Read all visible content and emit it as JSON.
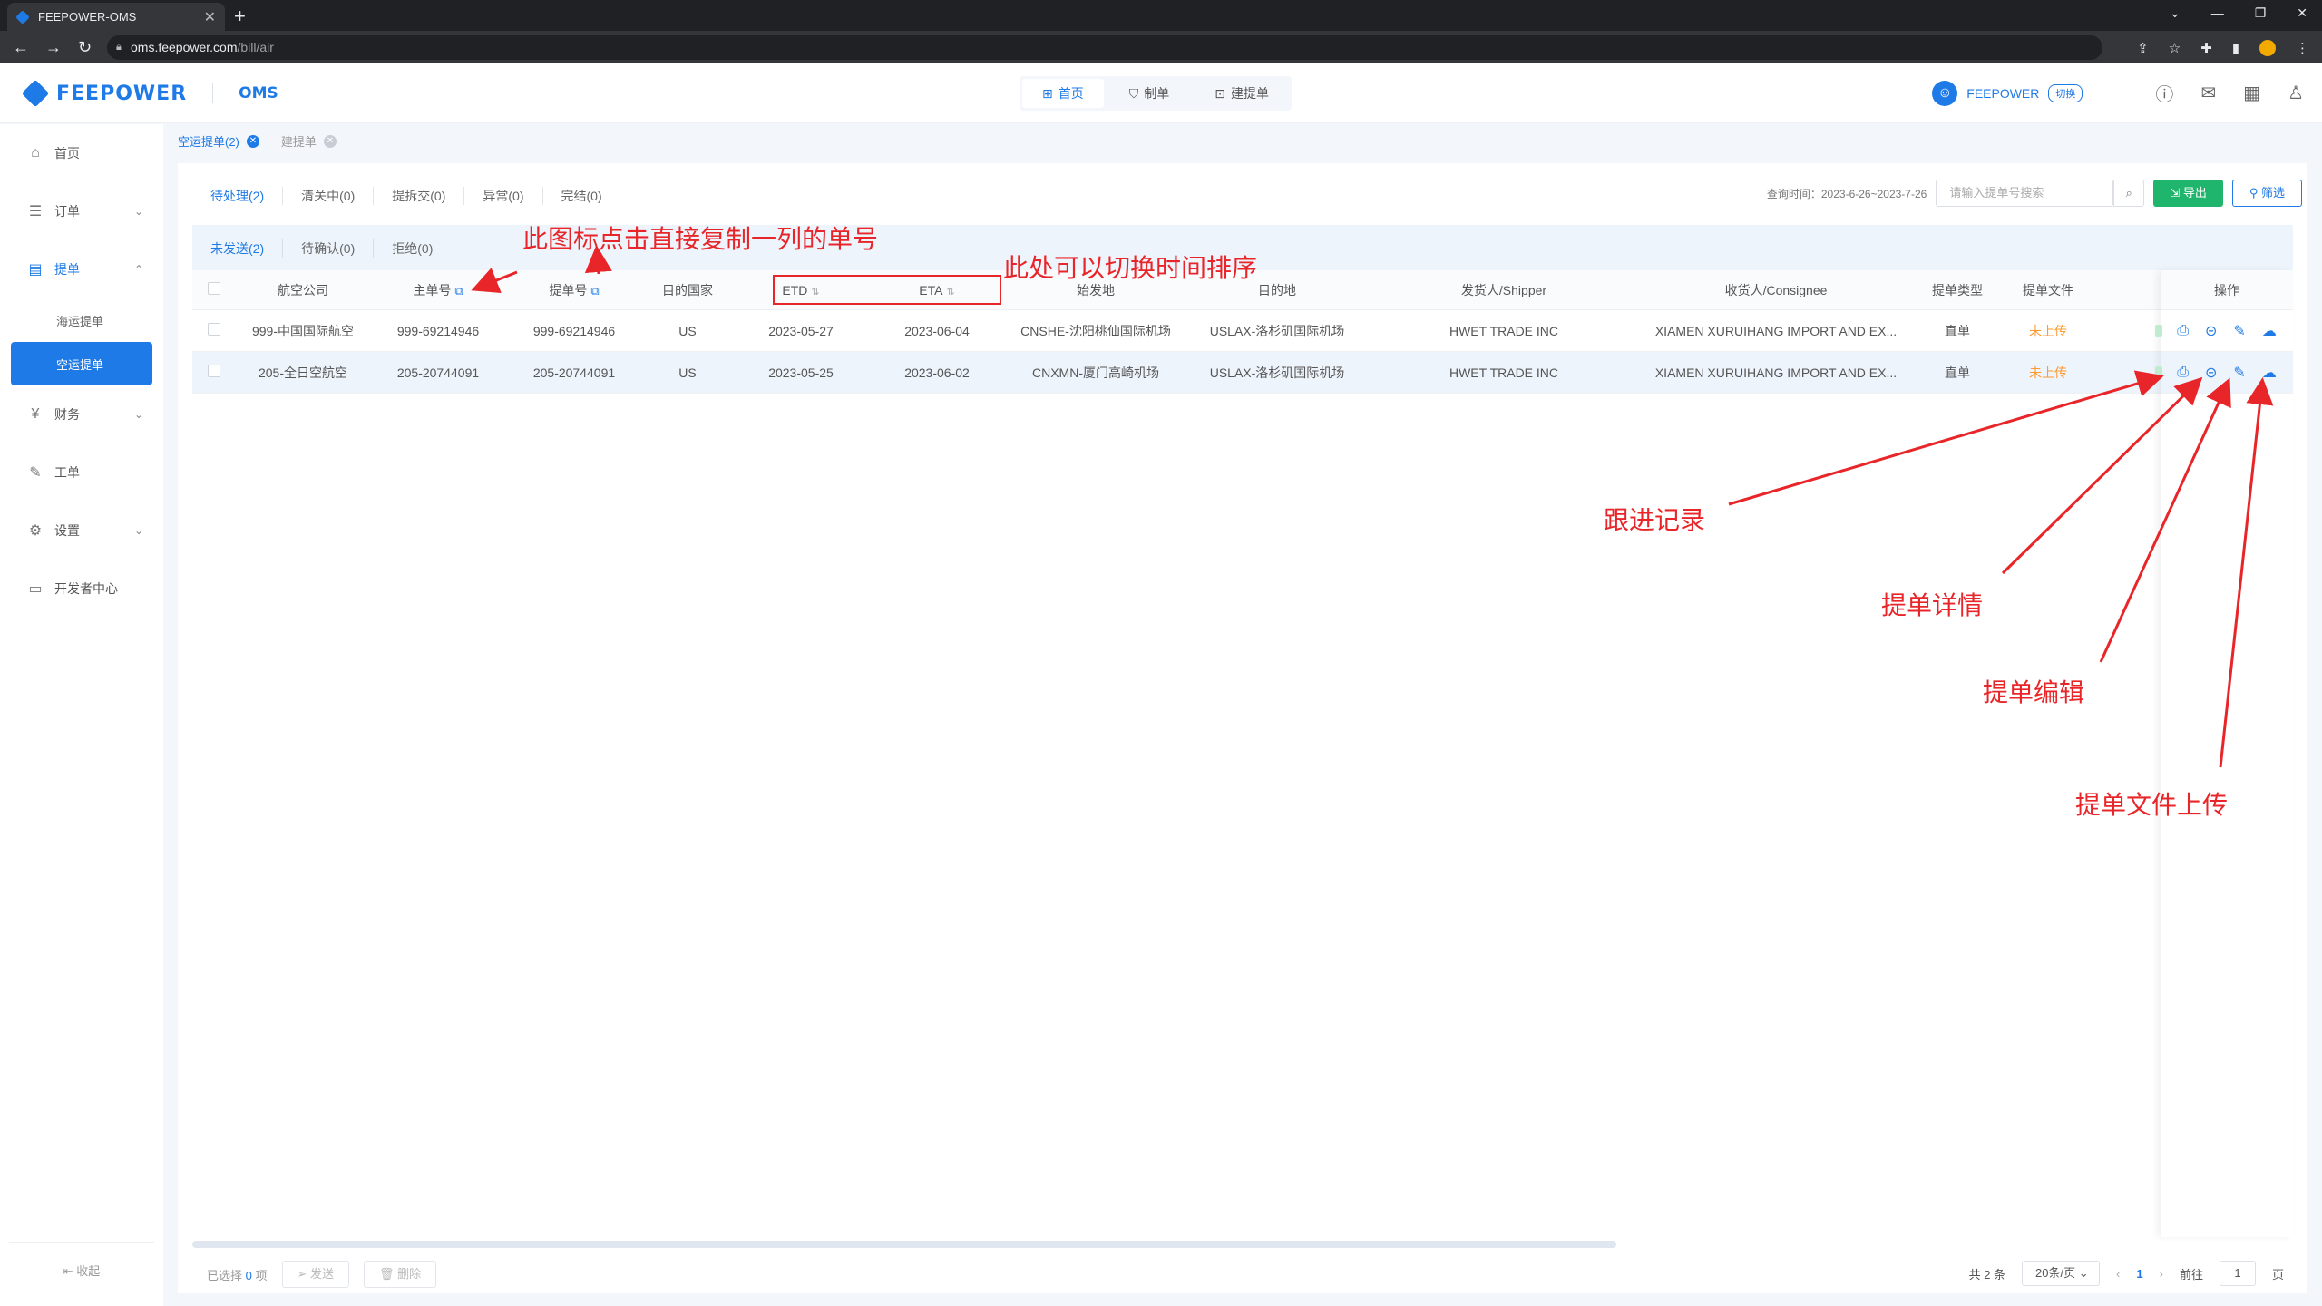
{
  "browser": {
    "tab_title": "FEEPOWER-OMS",
    "url_host": "oms.feepower.com",
    "url_path": "/bill/air"
  },
  "header": {
    "logo": "FEEPOWER",
    "sub_logo": "OMS",
    "nav": [
      {
        "label": "首页",
        "icon": "grid-icon"
      },
      {
        "label": "制单",
        "icon": "stamp-icon"
      },
      {
        "label": "建提单",
        "icon": "doc-plus-icon"
      }
    ],
    "user": "FEEPOWER",
    "switch": "切换"
  },
  "sidebar": {
    "items": [
      {
        "label": "首页"
      },
      {
        "label": "订单"
      },
      {
        "label": "提单"
      },
      {
        "label": "财务"
      },
      {
        "label": "工单"
      },
      {
        "label": "设置"
      },
      {
        "label": "开发者中心"
      }
    ],
    "sub_items": [
      {
        "label": "海运提单"
      },
      {
        "label": "空运提单"
      }
    ],
    "collapse": "收起"
  },
  "page_tabs": [
    {
      "label": "空运提单(2)"
    },
    {
      "label": "建提单"
    }
  ],
  "status_tabs": [
    "待处理(2)",
    "清关中(0)",
    "提拆交(0)",
    "异常(0)",
    "完结(0)"
  ],
  "sub_tabs": [
    "未发送(2)",
    "待确认(0)",
    "拒绝(0)"
  ],
  "toolbar": {
    "query_time": "查询时间：2023-6-26~2023-7-26",
    "search_placeholder": "请输入提单号搜索",
    "export": "导出",
    "filter": "筛选"
  },
  "table": {
    "headers": {
      "airline": "航空公司",
      "master": "主单号",
      "bill": "提单号",
      "dest_country": "目的国家",
      "etd": "ETD",
      "eta": "ETA",
      "origin": "始发地",
      "destination": "目的地",
      "shipper": "发货人/Shipper",
      "consignee": "收货人/Consignee",
      "bill_type": "提单类型",
      "bill_file": "提单文件",
      "ops": "操作"
    },
    "rows": [
      {
        "airline": "999-中国国际航空",
        "master": "999-69214946",
        "bill": "999-69214946",
        "dest_country": "US",
        "etd": "2023-05-27",
        "eta": "2023-06-04",
        "origin": "CNSHE-沈阳桃仙国际机场",
        "destination": "USLAX-洛杉矶国际机场",
        "shipper": "HWET TRADE INC",
        "consignee": "XIAMEN XURUIHANG IMPORT AND EX...",
        "bill_type": "直单",
        "bill_file": "未上传"
      },
      {
        "airline": "205-全日空航空",
        "master": "205-20744091",
        "bill": "205-20744091",
        "dest_country": "US",
        "etd": "2023-05-25",
        "eta": "2023-06-02",
        "origin": "CNXMN-厦门高崎机场",
        "destination": "USLAX-洛杉矶国际机场",
        "shipper": "HWET TRADE INC",
        "consignee": "XIAMEN XURUIHANG IMPORT AND EX...",
        "bill_type": "直单",
        "bill_file": "未上传"
      }
    ]
  },
  "footer": {
    "selected_prefix": "已选择",
    "selected_count": "0",
    "selected_suffix": "项",
    "send": "发送",
    "delete": "删除",
    "total": "共 2 条",
    "page_size": "20条/页",
    "page": "1",
    "goto": "前往",
    "goto_page": "1",
    "page_unit": "页"
  },
  "annotations": {
    "copy_hint": "此图标点击直接复制一列的单号",
    "sort_hint": "此处可以切换时间排序",
    "follow": "跟进记录",
    "detail": "提单详情",
    "edit": "提单编辑",
    "upload": "提单文件上传"
  },
  "colors": {
    "accent": "#1e7ae6",
    "export_green": "#1fb56c",
    "annotation_red": "#e8262a",
    "pending_orange": "#ff9a2e"
  }
}
